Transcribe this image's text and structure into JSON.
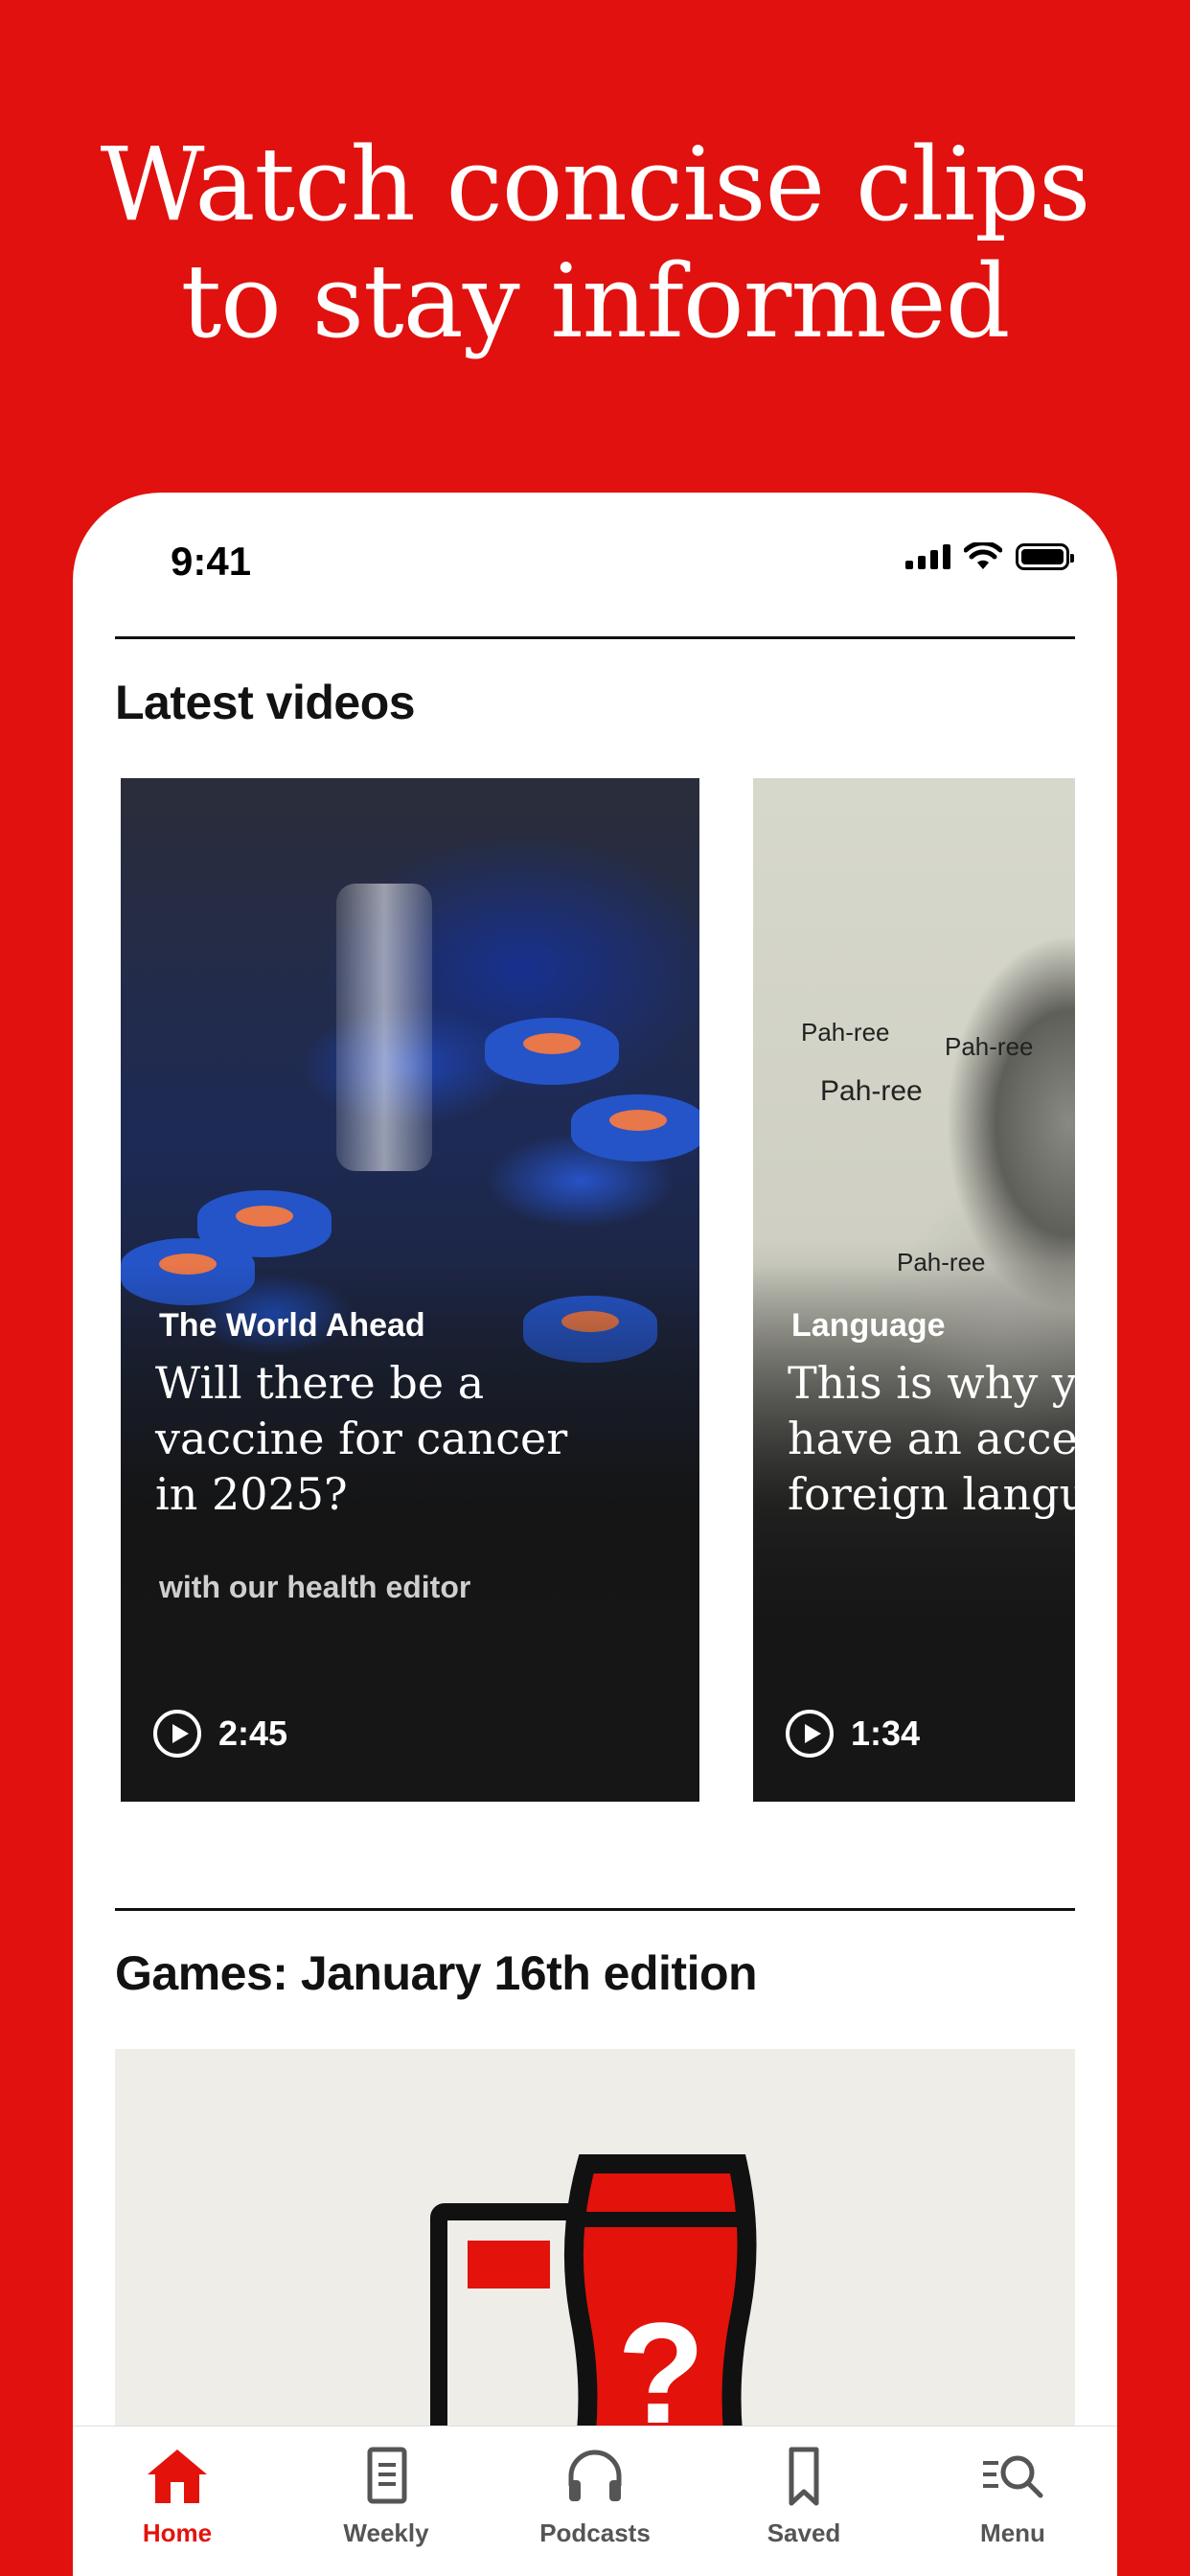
{
  "headline": {
    "line1": "Watch concise clips",
    "line2": "to stay informed"
  },
  "status_bar": {
    "time": "9:41"
  },
  "latest_videos": {
    "title": "Latest videos",
    "cards": [
      {
        "kicker": "The World Ahead",
        "title_lines": [
          "Will there be a",
          "vaccine for cancer",
          "in 2025?"
        ],
        "subtitle": "with our health editor",
        "duration": "2:45"
      },
      {
        "kicker": "Language",
        "title_lines": [
          "This is why yo",
          "have an accen",
          "foreign langu"
        ],
        "duration": "1:34",
        "overlay_word": "Pah-ree"
      }
    ]
  },
  "games": {
    "title": "Games: January 16th edition"
  },
  "tabbar": {
    "items": [
      {
        "label": "Home",
        "icon": "home-icon",
        "active": true
      },
      {
        "label": "Weekly",
        "icon": "document-icon",
        "active": false
      },
      {
        "label": "Podcasts",
        "icon": "headphones-icon",
        "active": false
      },
      {
        "label": "Saved",
        "icon": "bookmark-icon",
        "active": false
      },
      {
        "label": "Menu",
        "icon": "menu-search-icon",
        "active": false
      }
    ]
  },
  "colors": {
    "brand_red": "#E3120B",
    "background_red": "#E0110E",
    "text_dark": "#121212"
  }
}
